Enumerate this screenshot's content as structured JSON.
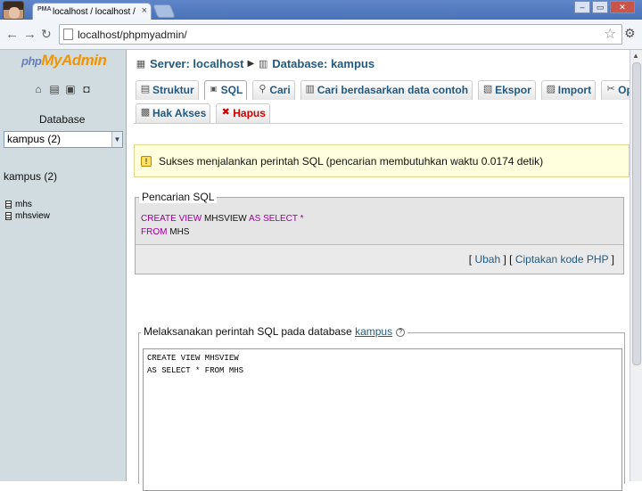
{
  "browser": {
    "tab_title": "localhost / localhost / kampus",
    "tab_favicon": "PMA",
    "tab_close": "×",
    "url": "localhost/phpmyadmin/",
    "window_buttons": [
      "–",
      "▭",
      "✕"
    ]
  },
  "sidebar": {
    "logo_php": "php",
    "logo_myadmin": "MyAdmin",
    "database_label": "Database",
    "database_selected": "kampus (2)",
    "db_heading": "kampus (2)",
    "tables": [
      "mhs",
      "mhsview"
    ]
  },
  "breadcrumb": {
    "server": "Server: localhost",
    "database": "Database: kampus"
  },
  "tabs_row1": [
    "Struktur",
    "SQL",
    "Cari",
    "Cari berdasarkan data contoh",
    "Ekspor",
    "Import",
    "Operasi"
  ],
  "tabs_row2": [
    "Hak Akses",
    "Hapus"
  ],
  "notice": {
    "text": "Sukses menjalankan perintah SQL (pencarian membutuhkan waktu 0.0174 detik)"
  },
  "sql_query": {
    "legend": "Pencarian SQL",
    "line1_kw1": "CREATE VIEW",
    "line1_name": "MHSVIEW",
    "line1_kw2": "AS SELECT *",
    "line2_kw": "FROM",
    "line2_name": "MHS",
    "link_edit": "Ubah",
    "link_php": "Ciptakan kode PHP"
  },
  "run_sql": {
    "legend_prefix": "Melaksanakan perintah SQL pada database",
    "legend_db": "kampus",
    "help": "?",
    "textarea_lines": [
      "CREATE VIEW MHSVIEW",
      "AS SELECT * FROM MHS"
    ]
  },
  "colors": {
    "link": "#235a81",
    "keyword": "#990099",
    "notice_bg": "#ffffdd",
    "sidebar_bg": "#d0dce0",
    "hapus": "#cc0000"
  }
}
